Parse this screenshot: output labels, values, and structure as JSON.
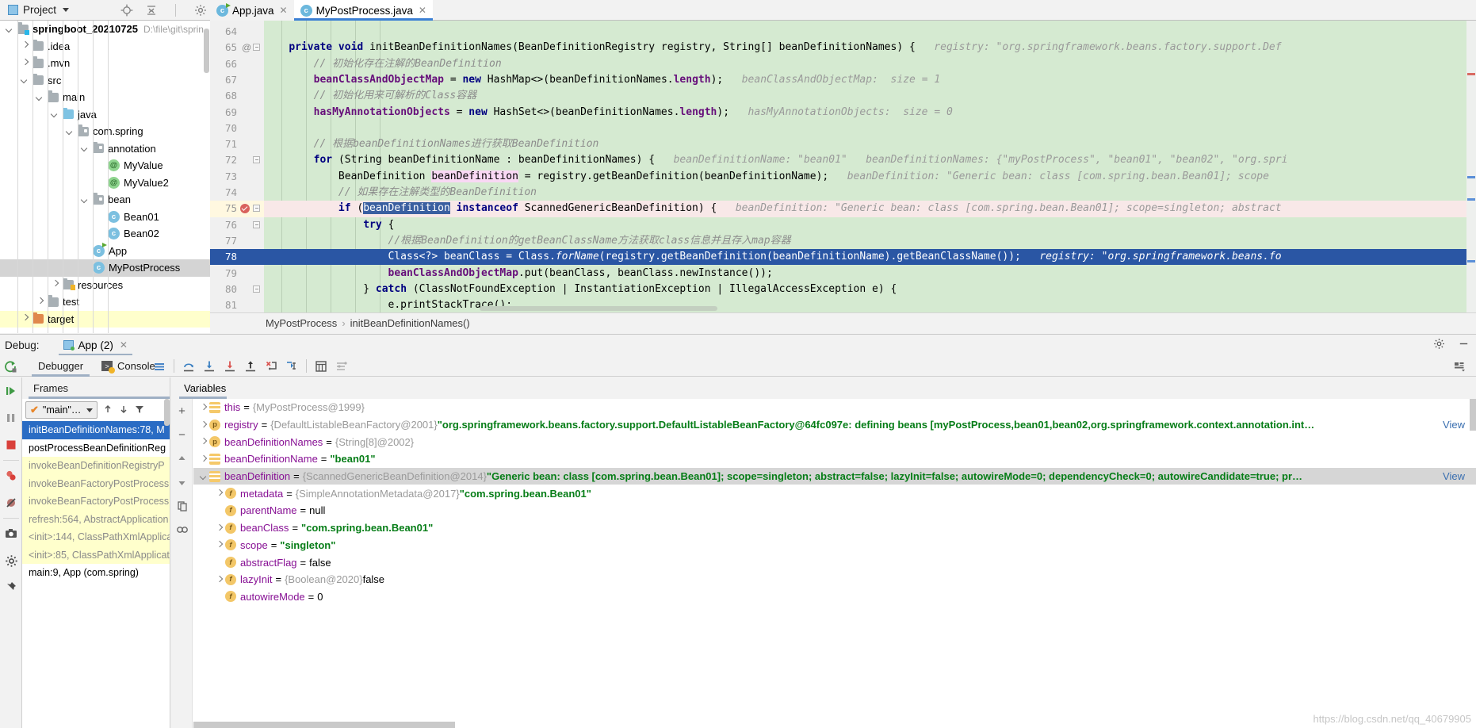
{
  "toolbar": {
    "project_label": "Project",
    "icons": [
      "locate-icon",
      "collapse-all-icon",
      "settings-gear-icon",
      "minimize-icon"
    ]
  },
  "editor_tabs": [
    {
      "label": "App.java",
      "icon": "java-class-run-icon",
      "active": false,
      "closable": true
    },
    {
      "label": "MyPostProcess.java",
      "icon": "java-class-icon",
      "active": true,
      "closable": true
    }
  ],
  "project_tree": [
    {
      "depth": 0,
      "twisty": "down",
      "icon": "module-folder",
      "label": "springboot_20210725",
      "bold": true,
      "path": "D:\\file\\git\\sprin",
      "state": "normal"
    },
    {
      "depth": 1,
      "twisty": "right",
      "icon": "folder",
      "label": ".idea",
      "state": "normal"
    },
    {
      "depth": 1,
      "twisty": "right",
      "icon": "folder",
      "label": ".mvn",
      "state": "normal"
    },
    {
      "depth": 1,
      "twisty": "down",
      "icon": "folder",
      "label": "src",
      "state": "normal"
    },
    {
      "depth": 2,
      "twisty": "down",
      "icon": "folder",
      "label": "main",
      "state": "normal"
    },
    {
      "depth": 3,
      "twisty": "down",
      "icon": "source-folder",
      "label": "java",
      "state": "normal"
    },
    {
      "depth": 4,
      "twisty": "down",
      "icon": "package-folder",
      "label": "com.spring",
      "state": "normal"
    },
    {
      "depth": 5,
      "twisty": "down",
      "icon": "package-folder",
      "label": "annotation",
      "state": "normal"
    },
    {
      "depth": 6,
      "twisty": "none",
      "icon": "annotation-class",
      "label": "MyValue",
      "state": "normal"
    },
    {
      "depth": 6,
      "twisty": "none",
      "icon": "annotation-class",
      "label": "MyValue2",
      "state": "normal"
    },
    {
      "depth": 5,
      "twisty": "down",
      "icon": "package-folder",
      "label": "bean",
      "state": "normal"
    },
    {
      "depth": 6,
      "twisty": "none",
      "icon": "java-class",
      "label": "Bean01",
      "state": "normal"
    },
    {
      "depth": 6,
      "twisty": "none",
      "icon": "java-class",
      "label": "Bean02",
      "state": "normal"
    },
    {
      "depth": 5,
      "twisty": "none",
      "icon": "java-class-run",
      "label": "App",
      "state": "normal"
    },
    {
      "depth": 5,
      "twisty": "none",
      "icon": "java-class",
      "label": "MyPostProcess",
      "state": "selected"
    },
    {
      "depth": 3,
      "twisty": "right",
      "icon": "resource-folder",
      "label": "resources",
      "state": "normal"
    },
    {
      "depth": 2,
      "twisty": "right",
      "icon": "folder",
      "label": "test",
      "state": "normal"
    },
    {
      "depth": 1,
      "twisty": "right",
      "icon": "target-folder",
      "label": "target",
      "state": "highlight"
    }
  ],
  "code": {
    "lines": [
      {
        "num": "64",
        "gutter": "",
        "text": "",
        "style": "normal"
      },
      {
        "num": "65",
        "gutter": "@",
        "fold": true,
        "style": "normal",
        "segments": [
          {
            "t": "    ",
            "c": "plain"
          },
          {
            "t": "private void ",
            "c": "kw"
          },
          {
            "t": "initBeanDefinitionNames(BeanDefinitionRegistry registry, String[] beanDefinitionNames) {",
            "c": "plain"
          },
          {
            "t": "   registry: \"org.springframework.beans.factory.support.Def",
            "c": "hint"
          }
        ]
      },
      {
        "num": "66",
        "gutter": "",
        "style": "normal",
        "segments": [
          {
            "t": "        // 初始化存在注解的BeanDefinition",
            "c": "cm"
          }
        ]
      },
      {
        "num": "67",
        "gutter": "",
        "style": "normal",
        "segments": [
          {
            "t": "        ",
            "c": "plain"
          },
          {
            "t": "beanClassAndObjectMap",
            "c": "fld"
          },
          {
            "t": " = ",
            "c": "plain"
          },
          {
            "t": "new ",
            "c": "kw"
          },
          {
            "t": "HashMap<>(beanDefinitionNames.",
            "c": "plain"
          },
          {
            "t": "length",
            "c": "fld"
          },
          {
            "t": ");",
            "c": "plain"
          },
          {
            "t": "   beanClassAndObjectMap:  size = 1",
            "c": "hint"
          }
        ]
      },
      {
        "num": "68",
        "gutter": "",
        "style": "normal",
        "segments": [
          {
            "t": "        // 初始化用来可解析的Class容器",
            "c": "cm"
          }
        ]
      },
      {
        "num": "69",
        "gutter": "",
        "style": "normal",
        "segments": [
          {
            "t": "        ",
            "c": "plain"
          },
          {
            "t": "hasMyAnnotationObjects",
            "c": "fld"
          },
          {
            "t": " = ",
            "c": "plain"
          },
          {
            "t": "new ",
            "c": "kw"
          },
          {
            "t": "HashSet<>(beanDefinitionNames.",
            "c": "plain"
          },
          {
            "t": "length",
            "c": "fld"
          },
          {
            "t": ");",
            "c": "plain"
          },
          {
            "t": "   hasMyAnnotationObjects:  size = 0",
            "c": "hint"
          }
        ]
      },
      {
        "num": "70",
        "gutter": "",
        "style": "normal",
        "segments": []
      },
      {
        "num": "71",
        "gutter": "",
        "style": "normal",
        "segments": [
          {
            "t": "        // 根据beanDefinitionNames进行获取BeanDefinition",
            "c": "cm"
          }
        ]
      },
      {
        "num": "72",
        "gutter": "",
        "fold": true,
        "style": "normal",
        "segments": [
          {
            "t": "        ",
            "c": "plain"
          },
          {
            "t": "for ",
            "c": "kw"
          },
          {
            "t": "(String beanDefinitionName : beanDefinitionNames) {",
            "c": "plain"
          },
          {
            "t": "   beanDefinitionName: \"bean01\"   beanDefinitionNames: {\"myPostProcess\", \"bean01\", \"bean02\", \"org.spri",
            "c": "hint"
          }
        ]
      },
      {
        "num": "73",
        "gutter": "",
        "style": "normal",
        "segments": [
          {
            "t": "            BeanDefinition ",
            "c": "plain"
          },
          {
            "t": "beanDefinition",
            "c": "pink"
          },
          {
            "t": " = registry.getBeanDefinition(beanDefinitionName);",
            "c": "plain"
          },
          {
            "t": "   beanDefinition: \"Generic bean: class [com.spring.bean.Bean01]; scope",
            "c": "hint"
          }
        ]
      },
      {
        "num": "74",
        "gutter": "",
        "style": "normal",
        "segments": [
          {
            "t": "            // 如果存在注解类型的BeanDefinition",
            "c": "cm"
          }
        ]
      },
      {
        "num": "75",
        "gutter": "",
        "breakpoint": true,
        "bulb": true,
        "fold": true,
        "style": "exec",
        "segments": [
          {
            "t": "            ",
            "c": "plain"
          },
          {
            "t": "if ",
            "c": "kw"
          },
          {
            "t": "(",
            "c": "plain"
          },
          {
            "t": "beanDefinition",
            "c": "selid"
          },
          {
            "t": " ",
            "c": "plain"
          },
          {
            "t": "instanceof ",
            "c": "kw"
          },
          {
            "t": "ScannedGenericBeanDefinition) {",
            "c": "plain"
          },
          {
            "t": "   beanDefinition: \"Generic bean: class [com.spring.bean.Bean01]; scope=singleton; abstract",
            "c": "hint"
          }
        ]
      },
      {
        "num": "76",
        "gutter": "",
        "fold": true,
        "style": "normal",
        "segments": [
          {
            "t": "                ",
            "c": "plain"
          },
          {
            "t": "try ",
            "c": "kw"
          },
          {
            "t": "{",
            "c": "plain"
          }
        ]
      },
      {
        "num": "77",
        "gutter": "",
        "style": "normal",
        "segments": [
          {
            "t": "                    //根据BeanDefinition的getBeanClassName方法获取class信息并且存入map容器",
            "c": "cm"
          }
        ]
      },
      {
        "num": "78",
        "gutter": "",
        "style": "current",
        "segments": [
          {
            "t": "                    Class<?> beanClass = Class.",
            "c": "plain"
          },
          {
            "t": "forName",
            "c": "mth"
          },
          {
            "t": "(registry.getBeanDefinition(beanDefinitionName).getBeanClassName());",
            "c": "plain"
          },
          {
            "t": "   registry: \"org.springframework.beans.fo",
            "c": "hint"
          }
        ]
      },
      {
        "num": "79",
        "gutter": "",
        "style": "normal",
        "segments": [
          {
            "t": "                    ",
            "c": "plain"
          },
          {
            "t": "beanClassAndObjectMap",
            "c": "fld"
          },
          {
            "t": ".put(beanClass, beanClass.newInstance());",
            "c": "plain"
          }
        ]
      },
      {
        "num": "80",
        "gutter": "",
        "fold": true,
        "style": "normal",
        "segments": [
          {
            "t": "                } ",
            "c": "plain"
          },
          {
            "t": "catch ",
            "c": "kw"
          },
          {
            "t": "(ClassNotFoundException | InstantiationException | IllegalAccessException e) {",
            "c": "plain"
          }
        ]
      },
      {
        "num": "81",
        "gutter": "",
        "style": "normal",
        "segments": [
          {
            "t": "                    e.printStackTrace();",
            "c": "plain"
          }
        ]
      }
    ]
  },
  "breadcrumb": {
    "class": "MyPostProcess",
    "separator": "›",
    "method": "initBeanDefinitionNames()"
  },
  "debug": {
    "label": "Debug:",
    "session": "App (2)",
    "tabs": [
      {
        "label": "Debugger",
        "icon": "debugger-tab-icon",
        "active": true
      },
      {
        "label": "Console",
        "icon": "console-icon",
        "active": false
      }
    ],
    "toolbar_icons": [
      "rerun-icon",
      "layout-icon",
      "step-over-icon",
      "step-into-icon",
      "force-step-into-icon",
      "step-out-icon",
      "drop-frame-icon",
      "run-to-cursor-icon",
      "evaluate-expression-icon",
      "settings-list-icon"
    ],
    "left_rail_icons": [
      "resume-program-icon",
      "pause-program-icon",
      "stop-icon",
      "view-breakpoints-icon",
      "mute-breakpoints-icon",
      "screenshot-icon",
      "settings-gear-icon",
      "pin-tab-icon"
    ],
    "header_right_icons": [
      "settings-gear-icon",
      "hide-panel-icon"
    ],
    "toolbar_right_icon": "restore-layout-icon"
  },
  "frames": {
    "title": "Frames",
    "thread": "\"main\"…",
    "nav_icons": [
      "frame-up-icon",
      "frame-down-icon",
      "filter-icon"
    ],
    "items": [
      {
        "label": "initBeanDefinitionNames:78, M",
        "state": "selected"
      },
      {
        "label": "postProcessBeanDefinitionReg",
        "state": "own"
      },
      {
        "label": "invokeBeanDefinitionRegistryP",
        "state": "library"
      },
      {
        "label": "invokeBeanFactoryPostProcess",
        "state": "library"
      },
      {
        "label": "invokeBeanFactoryPostProcess",
        "state": "library"
      },
      {
        "label": "refresh:564, AbstractApplication",
        "state": "library"
      },
      {
        "label": "<init>:144, ClassPathXmlApplica",
        "state": "library"
      },
      {
        "label": "<init>:85, ClassPathXmlApplicat",
        "state": "library"
      },
      {
        "label": "main:9, App (com.spring)",
        "state": "own-italic"
      }
    ]
  },
  "variables": {
    "title": "Variables",
    "rail_icons": [
      "add-watch-icon",
      "remove-watch-icon",
      "move-up-icon",
      "move-down-icon",
      "copy-value-icon",
      "inspect-icon"
    ],
    "rows": [
      {
        "indent": 0,
        "twisty": "right",
        "icon": "stack-frame",
        "name": "this",
        "eq": "=",
        "ref": "{MyPostProcess@1999}",
        "str": "",
        "val": "",
        "view": ""
      },
      {
        "indent": 0,
        "twisty": "right",
        "icon": "param",
        "name": "registry",
        "eq": "=",
        "ref": "{DefaultListableBeanFactory@2001}",
        "str": "\"org.springframework.beans.factory.support.DefaultListableBeanFactory@64fc097e: defining beans [myPostProcess,bean01,bean02,org.springframework.context.annotation.int…",
        "val": "",
        "view": "View"
      },
      {
        "indent": 0,
        "twisty": "right",
        "icon": "param",
        "name": "beanDefinitionNames",
        "eq": "=",
        "ref": "{String[8]@2002}",
        "str": "",
        "val": "",
        "view": ""
      },
      {
        "indent": 0,
        "twisty": "right",
        "icon": "stack-frame",
        "name": "beanDefinitionName",
        "eq": "=",
        "ref": "",
        "str": "\"bean01\"",
        "val": "",
        "view": ""
      },
      {
        "indent": 0,
        "twisty": "down",
        "icon": "stack-frame",
        "name": "beanDefinition",
        "eq": "=",
        "ref": "{ScannedGenericBeanDefinition@2014}",
        "str": "\"Generic bean: class [com.spring.bean.Bean01]; scope=singleton; abstract=false; lazyInit=false; autowireMode=0; dependencyCheck=0; autowireCandidate=true; pr…",
        "val": "",
        "view": "View",
        "selected": true
      },
      {
        "indent": 1,
        "twisty": "right",
        "icon": "field",
        "name": "metadata",
        "eq": "=",
        "ref": "{SimpleAnnotationMetadata@2017}",
        "str": "\"com.spring.bean.Bean01\"",
        "val": "",
        "view": ""
      },
      {
        "indent": 1,
        "twisty": "none",
        "icon": "field",
        "name": "parentName",
        "eq": "=",
        "ref": "",
        "str": "",
        "val": "null",
        "view": ""
      },
      {
        "indent": 1,
        "twisty": "right",
        "icon": "field",
        "name": "beanClass",
        "eq": "=",
        "ref": "",
        "str": "\"com.spring.bean.Bean01\"",
        "val": "",
        "view": ""
      },
      {
        "indent": 1,
        "twisty": "right",
        "icon": "field",
        "name": "scope",
        "eq": "=",
        "ref": "",
        "str": "\"singleton\"",
        "val": "",
        "view": ""
      },
      {
        "indent": 1,
        "twisty": "none",
        "icon": "field",
        "name": "abstractFlag",
        "eq": "=",
        "ref": "",
        "str": "",
        "val": "false",
        "view": ""
      },
      {
        "indent": 1,
        "twisty": "right",
        "icon": "field",
        "name": "lazyInit",
        "eq": "=",
        "ref": "{Boolean@2020}",
        "str": "",
        "val": "false",
        "view": ""
      },
      {
        "indent": 1,
        "twisty": "none",
        "icon": "field",
        "name": "autowireMode",
        "eq": "=",
        "ref": "",
        "str": "",
        "val": "0",
        "view": ""
      }
    ]
  },
  "watermark": "https://blog.csdn.net/qq_40679905"
}
